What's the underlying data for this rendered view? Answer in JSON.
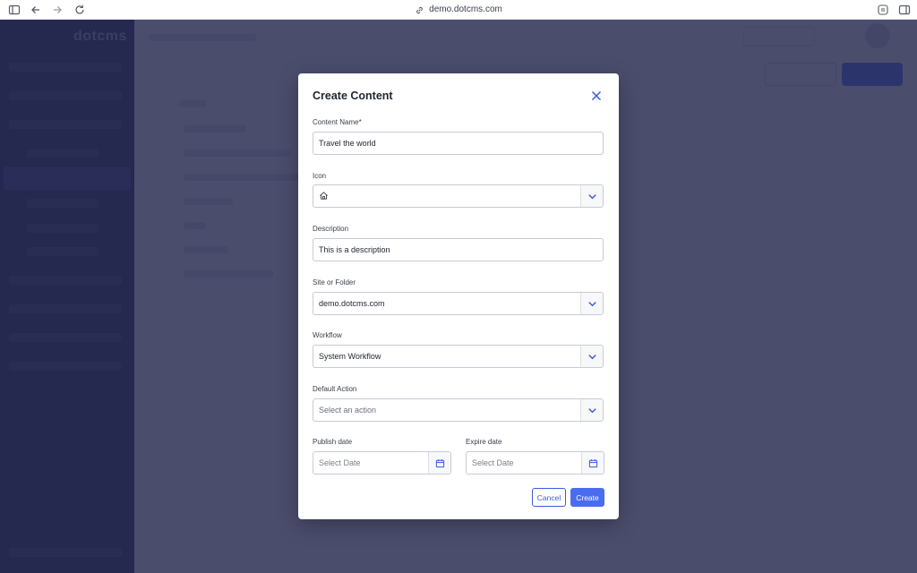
{
  "browser": {
    "url": "demo.dotcms.com"
  },
  "background_app": {
    "logo": "dotcms"
  },
  "dialog": {
    "title": "Create Content",
    "fields": {
      "content_name": {
        "label": "Content Name",
        "required_mark": "*",
        "value": "Travel the world"
      },
      "icon": {
        "label": "Icon",
        "icon_name": "home-icon"
      },
      "description": {
        "label": "Description",
        "value": "This is a description"
      },
      "site": {
        "label": "Site or Folder",
        "value": "demo.dotcms.com"
      },
      "workflow": {
        "label": "Workflow",
        "value": "System Workflow"
      },
      "default_action": {
        "label": "Default Action",
        "placeholder": "Select an action"
      },
      "publish_date": {
        "label": "Publish date",
        "placeholder": "Select Date"
      },
      "expire_date": {
        "label": "Expire date",
        "placeholder": "Select Date"
      }
    },
    "buttons": {
      "cancel": "Cancel",
      "create": "Create"
    }
  },
  "colors": {
    "primary": "#4a6cf0",
    "sidebar": "#262a53",
    "overlay": "#26284e"
  }
}
